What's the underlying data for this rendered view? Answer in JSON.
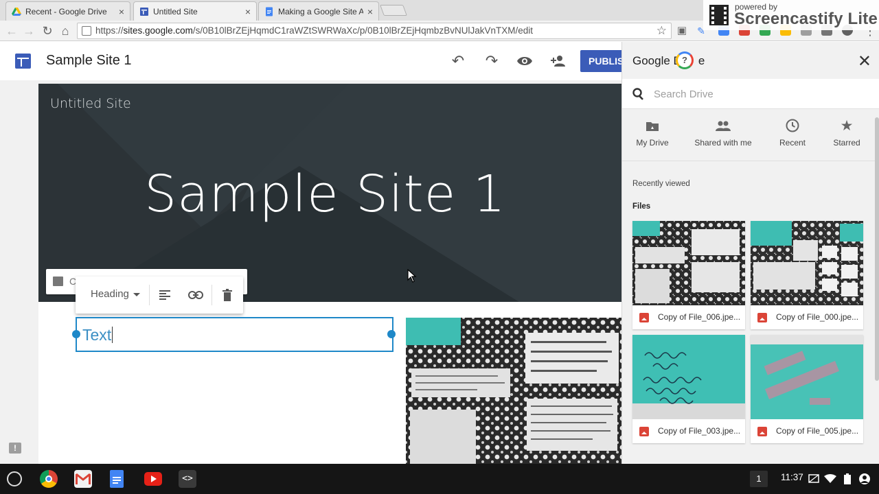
{
  "browser": {
    "tabs": [
      {
        "title": "Recent - Google Drive",
        "close": "×",
        "active": false,
        "favicon_color": "#1fa463"
      },
      {
        "title": "Untitled Site",
        "close": "×",
        "active": true,
        "favicon_color": "#3b5cb8"
      },
      {
        "title": "Making a Google Site Ab",
        "close": "×",
        "active": false,
        "favicon_color": "#4285f4"
      }
    ],
    "url": "https://sites.google.com/s/0B10lBrZEjHqmdC1raWZtSWRWaXc/p/0B10lBrZEjHqmbzBvNUlJakVnTXM/edit",
    "url_prefix": "https://",
    "url_domain": "sites.google.com",
    "url_path": "/s/0B10lBrZEjHqmdC1raWZtSWRWaXc/p/0B10lBrZEjHqmbzBvNUlJakVnTXM/edit"
  },
  "watermark": {
    "small": "powered by",
    "name": "Screencastify Lite"
  },
  "sites": {
    "site_name": "Sample Site 1",
    "publish_label": "PUBLISH",
    "banner_small_title": "Untitled Site",
    "banner_big_title": "Sample Site 1",
    "image_chip_label": "C",
    "format_toolbar": {
      "style_label": "Heading"
    },
    "textbox_value": "Text",
    "feedback_label": "!"
  },
  "drive": {
    "title": "Google Drive",
    "title_visible": "Google D",
    "title_tail": "e",
    "search_placeholder": "Search Drive",
    "tabs": [
      {
        "label": "My Drive",
        "icon": "my-drive-icon"
      },
      {
        "label": "Shared with me",
        "icon": "shared-icon"
      },
      {
        "label": "Recent",
        "icon": "clock-icon"
      },
      {
        "label": "Starred",
        "icon": "star-icon"
      }
    ],
    "recently_viewed_label": "Recently viewed",
    "files_label": "Files",
    "files": [
      {
        "name": "Copy of File_006.jpe..."
      },
      {
        "name": "Copy of File_000.jpe..."
      },
      {
        "name": "Copy of File_003.jpe..."
      },
      {
        "name": "Copy of File_005.jpe..."
      }
    ]
  },
  "shelf": {
    "badge": "1",
    "time": "11:37"
  },
  "colors": {
    "accent": "#3b5cb8",
    "selection": "#1e88c8",
    "teal": "#3ebdb2"
  }
}
